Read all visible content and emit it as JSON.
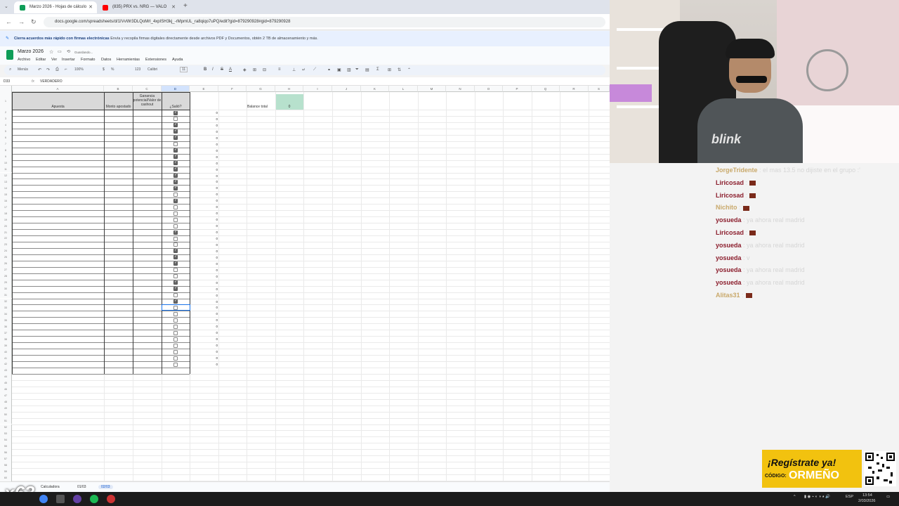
{
  "browser": {
    "tabs": [
      {
        "title": "Marzo 2026 - Hojas de cálculo",
        "active": true
      },
      {
        "title": "(835) PRX vs. NRG — VALO",
        "active": false
      }
    ],
    "url": "docs.google.com/spreadsheets/d/1IVvWr3DLQoMrl_4xpISH3kj_-rMpmUL_ra8qiqo7uPQ/edit?gid=879290928#gid=879290928"
  },
  "banner": {
    "bold": "Cierra acuerdos más rápido con firmas electrónicas",
    "text": "Envía y recopila firmas digitales directamente desde archivos PDF y Documentos, obtén 2 TB de almacenamiento y más."
  },
  "doc": {
    "title": "Marzo 2026",
    "status": "Guardando...",
    "menus": [
      "Archivo",
      "Editar",
      "Ver",
      "Insertar",
      "Formato",
      "Datos",
      "Herramientas",
      "Extensiones",
      "Ayuda"
    ]
  },
  "toolbar": {
    "search": "Menús",
    "zoom": "100%",
    "font": "Calibri",
    "size": "11",
    "format": "123"
  },
  "formula_bar": {
    "cell": "D33",
    "value": "VERDADERO"
  },
  "sheet": {
    "columns": [
      "A",
      "B",
      "C",
      "D",
      "E",
      "F",
      "G",
      "H",
      "I",
      "J",
      "K",
      "L",
      "M",
      "N",
      "O",
      "P",
      "Q",
      "R",
      "S"
    ],
    "headers": {
      "a": "Apuesta",
      "b": "Monto apostado",
      "c": "Ganancia potencial/Valor de cashout",
      "d": "¿Salió?"
    },
    "balance_label": "Balance total",
    "balance_value": "0",
    "zero_value": "0",
    "checkboxes": [
      true,
      false,
      true,
      true,
      true,
      false,
      true,
      true,
      true,
      true,
      true,
      true,
      true,
      false,
      true,
      false,
      false,
      false,
      false,
      true,
      false,
      false,
      true,
      true,
      true,
      false,
      false,
      true,
      true,
      false,
      true,
      false,
      false,
      false,
      false,
      false,
      false,
      false,
      false,
      false,
      false
    ]
  },
  "sheet_tabs": [
    "Calculadora",
    "01/03",
    "02/03"
  ],
  "chat": [
    {
      "user": "JorgeTridente",
      "msg": ": el mas 13.5 no dijiste en el grupo :'",
      "gold": true
    },
    {
      "user": "Liricosad",
      "msg": ":",
      "emote": true
    },
    {
      "user": "Liricosad",
      "msg": ":",
      "emote": true
    },
    {
      "user": "Nichito",
      "msg": ":",
      "emote": true,
      "gold": true
    },
    {
      "user": "yosueda",
      "msg": ": ya ahora real madrid"
    },
    {
      "user": "Liricosad",
      "msg": ":",
      "emote": true
    },
    {
      "user": "yosueda",
      "msg": ": ya ahora real madrid"
    },
    {
      "user": "yosueda",
      "msg": ": v"
    },
    {
      "user": "yosueda",
      "msg": ": ya ahora real madrid"
    },
    {
      "user": "yosueda",
      "msg": ": ya ahora real madrid"
    },
    {
      "user": "Alitas31",
      "msg": ":",
      "emote": true,
      "gold": true
    }
  ],
  "ad": {
    "title": "¡Regístrate ya!",
    "code_label": "CÓDIGO:",
    "code": "ORMEÑO"
  },
  "overlay": {
    "counter": "x63"
  },
  "taskbar": {
    "lang": "ESP",
    "time": "13:54",
    "date": "2/03/2026"
  }
}
